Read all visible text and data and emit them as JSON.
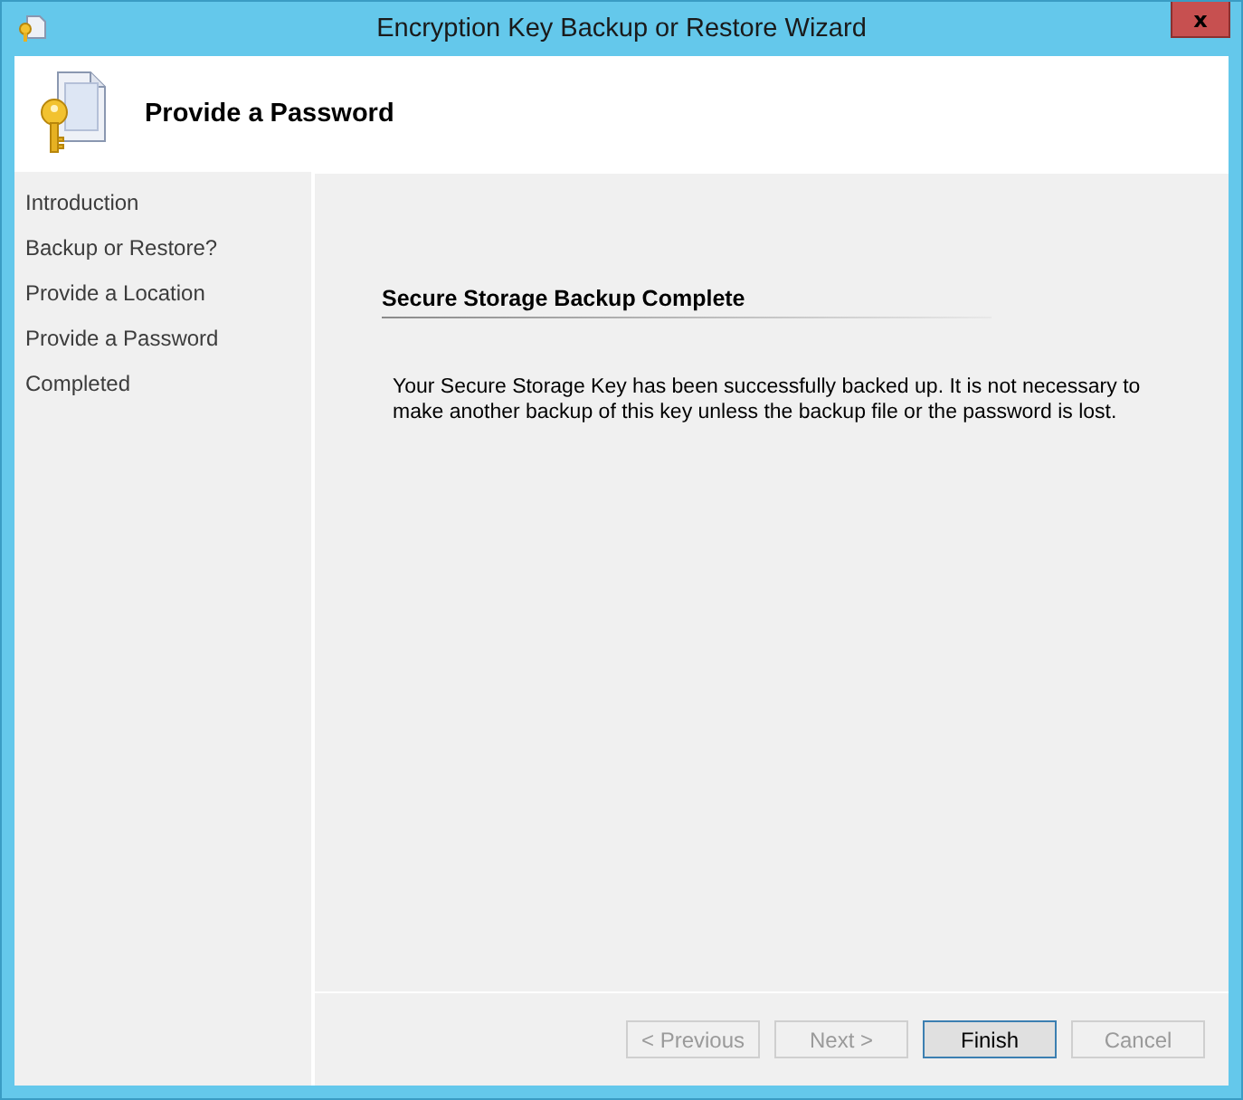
{
  "window": {
    "title": "Encryption Key Backup or Restore Wizard",
    "close_label": "x"
  },
  "header": {
    "title": "Provide a Password"
  },
  "steps": [
    {
      "label": "Introduction"
    },
    {
      "label": "Backup or Restore?"
    },
    {
      "label": "Provide a Location"
    },
    {
      "label": "Provide a Password"
    },
    {
      "label": "Completed"
    }
  ],
  "content": {
    "heading": "Secure Storage Backup Complete",
    "message": "Your Secure Storage Key has been successfully backed up.  It is not necessary to make another backup of this key unless the backup file or the password is lost."
  },
  "buttons": [
    {
      "label": "< Previous",
      "disabled": true,
      "default": false
    },
    {
      "label": "Next >",
      "disabled": true,
      "default": false
    },
    {
      "label": "Finish",
      "disabled": false,
      "default": true
    },
    {
      "label": "Cancel",
      "disabled": true,
      "default": false
    }
  ]
}
